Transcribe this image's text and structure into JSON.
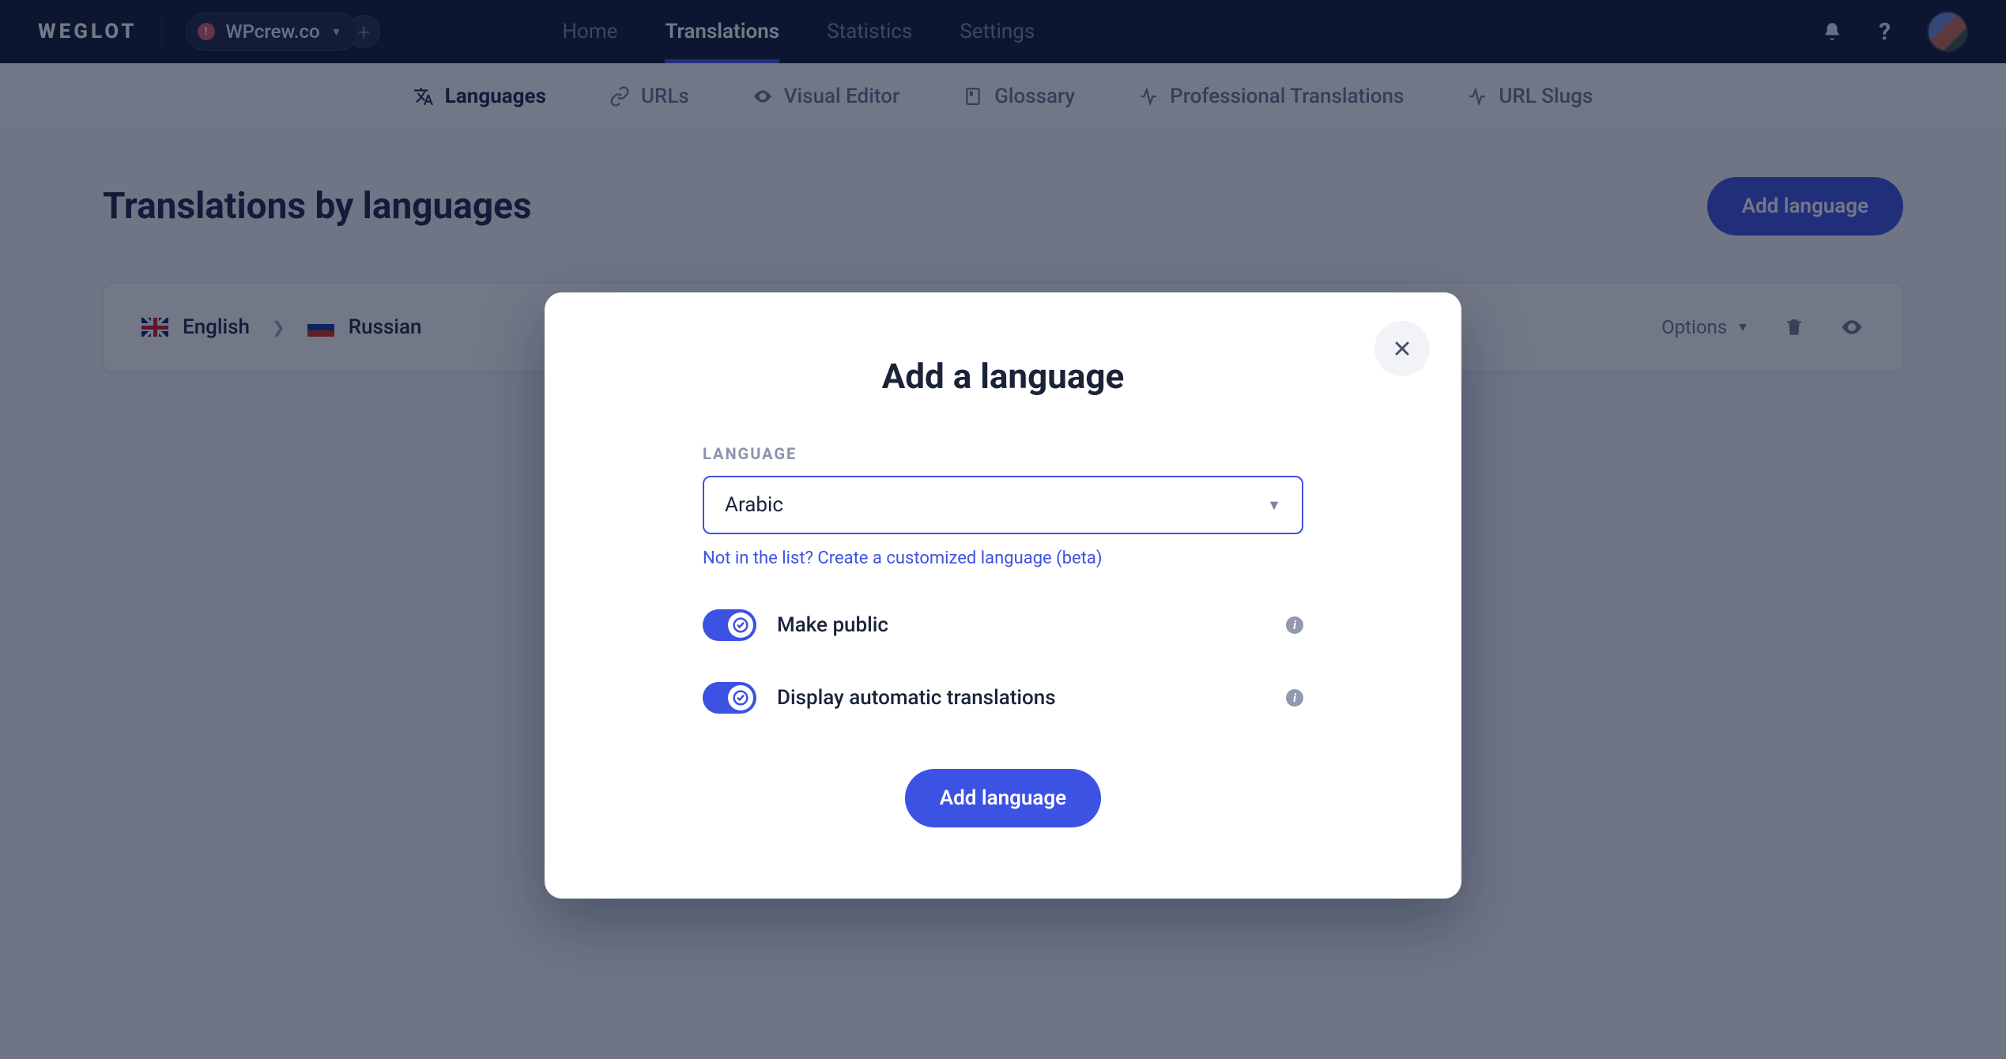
{
  "brand": "WEGLOT",
  "site_switcher": {
    "name": "WPcrew.co"
  },
  "topnav": {
    "items": [
      {
        "label": "Home",
        "active": false
      },
      {
        "label": "Translations",
        "active": true
      },
      {
        "label": "Statistics",
        "active": false
      },
      {
        "label": "Settings",
        "active": false
      }
    ]
  },
  "subnav": {
    "items": [
      {
        "label": "Languages",
        "icon": "translate-icon",
        "active": true
      },
      {
        "label": "URLs",
        "icon": "link-icon",
        "active": false
      },
      {
        "label": "Visual Editor",
        "icon": "eye-icon",
        "active": false
      },
      {
        "label": "Glossary",
        "icon": "book-icon",
        "active": false
      },
      {
        "label": "Professional Translations",
        "icon": "pulse-icon",
        "active": false
      },
      {
        "label": "URL Slugs",
        "icon": "pulse-icon",
        "active": false
      }
    ]
  },
  "page": {
    "title": "Translations by languages",
    "add_button": "Add language"
  },
  "language_row": {
    "source": "English",
    "target": "Russian",
    "options_label": "Options"
  },
  "modal": {
    "title": "Add a language",
    "field_label": "LANGUAGE",
    "selected_language": "Arabic",
    "helper_link": "Not in the list? Create a customized language (beta)",
    "toggle_public": "Make public",
    "toggle_auto": "Display automatic translations",
    "submit": "Add language"
  }
}
